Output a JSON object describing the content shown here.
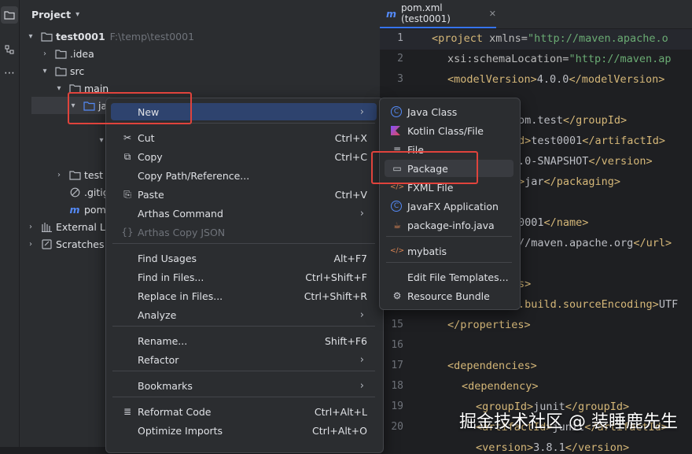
{
  "activity": {
    "icons": [
      "folder-icon",
      "structure-icon",
      "more-icon"
    ],
    "more_glyph": "⋯"
  },
  "project": {
    "title": "Project",
    "tree": [
      {
        "label": "test0001",
        "hint": "F:\\temp\\test0001",
        "icon": "folder-icon"
      },
      {
        "label": ".idea",
        "icon": "folder-icon"
      },
      {
        "label": "src",
        "icon": "folder-icon"
      },
      {
        "label": "main",
        "icon": "folder-icon"
      },
      {
        "label": "ja",
        "icon": "source-folder-icon"
      },
      {
        "label": "test",
        "icon": "folder-icon"
      },
      {
        "label": ".gitigno",
        "icon": "gitignore-icon"
      },
      {
        "label": "pom.xm",
        "icon": "maven-icon"
      },
      {
        "label": "External Lil",
        "icon": "library-icon"
      },
      {
        "label": "Scratches a",
        "icon": "scratches-icon"
      }
    ]
  },
  "editor": {
    "tab_label": "pom.xml (test0001)",
    "tab_icon": "m",
    "line_numbers": [
      "1",
      "2",
      "3",
      "",
      "",
      "",
      "",
      "",
      "",
      "",
      "",
      "",
      "",
      "",
      "15",
      "16",
      "17",
      "18",
      "19",
      "20"
    ]
  },
  "context_menu": {
    "items": [
      {
        "label": "New",
        "shortcut": "",
        "submenu": true
      },
      {
        "label": "Cut",
        "shortcut": "Ctrl+X"
      },
      {
        "label": "Copy",
        "shortcut": "Ctrl+C"
      },
      {
        "label": "Copy Path/Reference...",
        "shortcut": ""
      },
      {
        "label": "Paste",
        "shortcut": "Ctrl+V"
      },
      {
        "label": "Arthas Command",
        "shortcut": "",
        "submenu": true
      },
      {
        "label": "Arthas Copy JSON",
        "shortcut": "",
        "disabled": true
      },
      {
        "label": "Find Usages",
        "shortcut": "Alt+F7"
      },
      {
        "label": "Find in Files...",
        "shortcut": "Ctrl+Shift+F"
      },
      {
        "label": "Replace in Files...",
        "shortcut": "Ctrl+Shift+R"
      },
      {
        "label": "Analyze",
        "shortcut": "",
        "submenu": true
      },
      {
        "label": "Rename...",
        "shortcut": "Shift+F6"
      },
      {
        "label": "Refactor",
        "shortcut": "",
        "submenu": true
      },
      {
        "label": "Bookmarks",
        "shortcut": "",
        "submenu": true
      },
      {
        "label": "Reformat Code",
        "shortcut": "Ctrl+Alt+L"
      },
      {
        "label": "Optimize Imports",
        "shortcut": "Ctrl+Alt+O"
      }
    ]
  },
  "new_submenu": {
    "items": [
      {
        "label": "Java Class"
      },
      {
        "label": "Kotlin Class/File"
      },
      {
        "label": "File"
      },
      {
        "label": "Package"
      },
      {
        "label": "FXML File"
      },
      {
        "label": "JavaFX Application"
      },
      {
        "label": "package-info.java"
      },
      {
        "label": "mybatis"
      },
      {
        "label": "Edit File Templates..."
      },
      {
        "label": "Resource Bundle"
      }
    ]
  },
  "watermark": "掘金技术社区 @ 装睡鹿先生",
  "colors": {
    "accent": "#3574f0",
    "highlight_box": "#e0433c",
    "xml_tag": "#d5b778",
    "xml_string": "#6aab73"
  }
}
